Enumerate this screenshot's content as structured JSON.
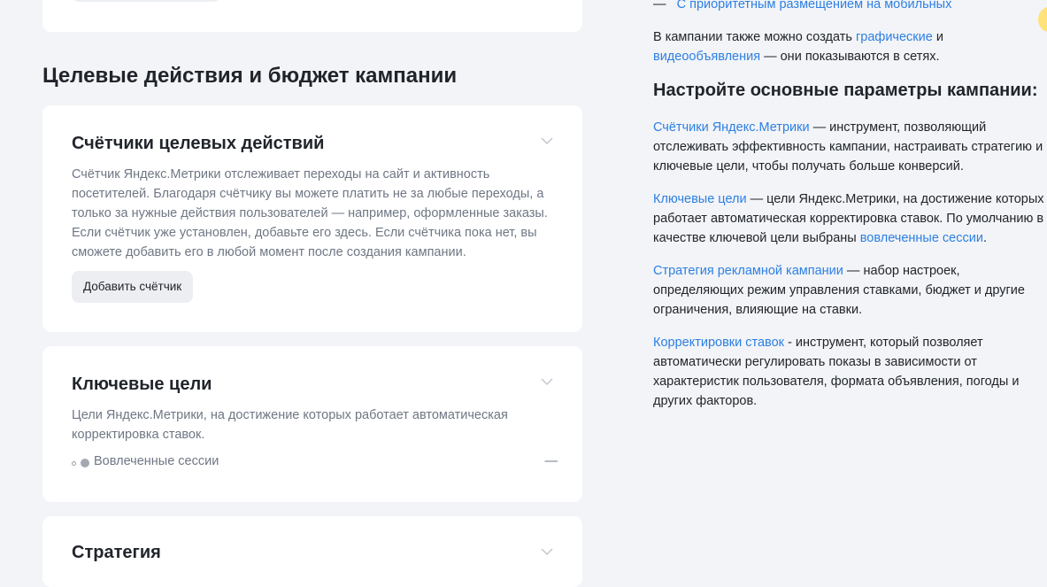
{
  "left": {
    "section_title": "Целевые действия и бюджет кампании",
    "cards": {
      "counters": {
        "title": "Счётчики целевых действий",
        "description": "Счётчик Яндекс.Метрики отслеживает переходы на сайт и активность посетителей. Благодаря счётчику вы можете платить не за любые переходы, а только за нужные действия пользователей — например, оформленные заказы. Если счётчик уже установлен, добавьте его здесь. Если счётчика пока нет, вы сможете добавить его в любой момент после создания кампании.",
        "button_label": "Добавить счётчик"
      },
      "key_goals": {
        "title": "Ключевые цели",
        "description": "Цели Яндекс.Метрики, на достижение которых работает автоматическая корректировка ставок.",
        "session_label": "Вовлеченные сессии",
        "session_value": "—"
      },
      "strategy": {
        "title": "Стратегия"
      }
    }
  },
  "right": {
    "top_line": {
      "dash": "—",
      "link": "С приоритетным размещением на мобильных"
    },
    "ads_para": {
      "text1": "В кампании также можно создать ",
      "link1": "графические",
      "text2": " и ",
      "link2": "видеообъявления",
      "text3": " — они показываются в сетях."
    },
    "heading": "Настройте основные параметры кампании:",
    "items": [
      {
        "link": "Счётчики Яндекс.Метрики",
        "text": " — инструмент, позволяющий отслеживать эффективность кампании, настраивать стратегию и ключевые цели, чтобы получать больше конверсий."
      },
      {
        "link": "Ключевые цели",
        "text": " — цели Яндекс.Метрики, на достижение которых работает автоматическая корректировка ставок. По умолчанию в качестве ключевой цели выбраны ",
        "link2": "вовлеченные сессии",
        "text2": "."
      },
      {
        "link": "Стратегия рекламной кампании",
        "text": " — набор настроек, определяющих режим управления ставками, бюджет и другие ограничения, влияющие на ставки."
      },
      {
        "link": "Корректировки ставок",
        "text": " - инструмент, который позволяет автоматически регулировать показы в зависимости от характеристик пользователя, формата объявления, погоды и других факторов."
      }
    ]
  },
  "colors": {
    "background": "#f2f4f7",
    "link": "#2d7fe3",
    "muted_text": "#6f7784",
    "button_bg": "#eceef2"
  }
}
